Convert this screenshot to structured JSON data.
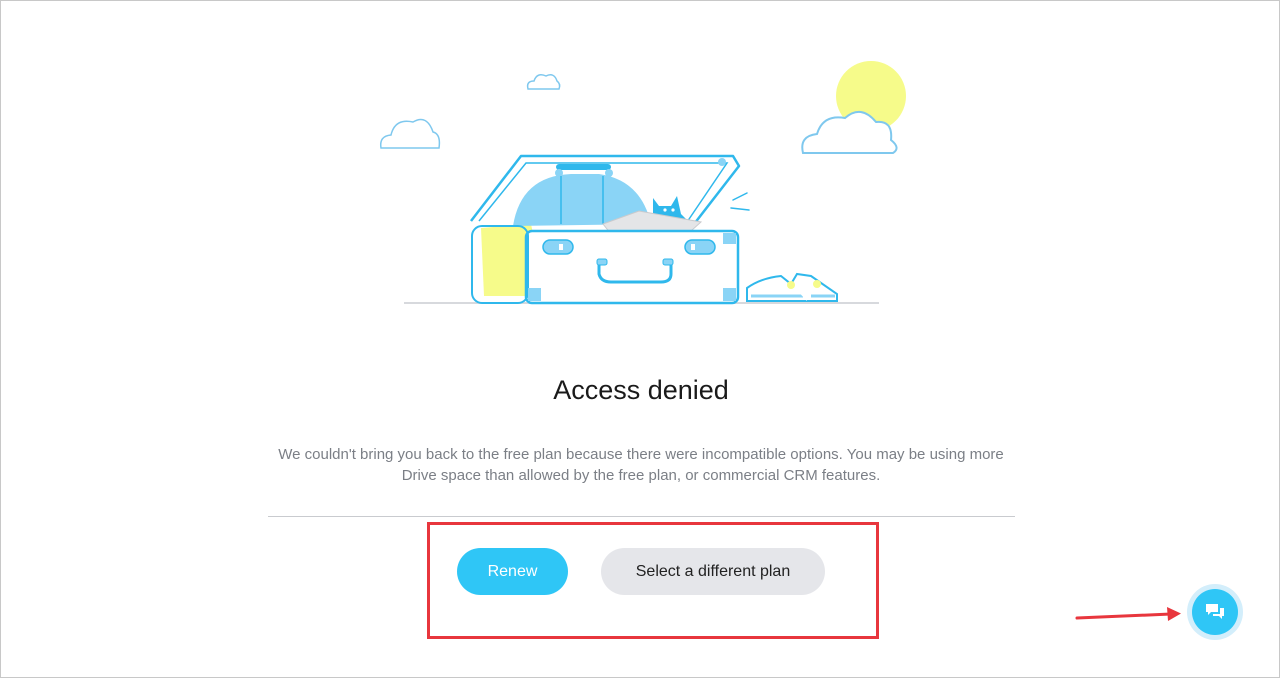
{
  "page": {
    "title": "Access denied",
    "description": "We couldn't bring you back to the free plan because there were incompatible options. You may be using more Drive space than allowed by the free plan, or commercial CRM features."
  },
  "actions": {
    "renew_label": "Renew",
    "select_plan_label": "Select a different plan"
  },
  "chat_widget": {
    "icon": "chat-bubbles-icon"
  },
  "illustration": {
    "icon": "open-suitcase-cat-illustration"
  },
  "colors": {
    "accent": "#2fc6f6",
    "secondary_button": "#e5e6ea",
    "annotation": "#e8363d",
    "sun": "#f6fb8a"
  }
}
